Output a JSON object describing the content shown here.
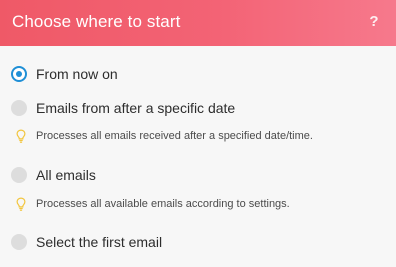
{
  "header": {
    "title": "Choose where to start",
    "help_label": "?"
  },
  "colors": {
    "accent": "#1f8fd6",
    "header_gradient_start": "#ef5967",
    "header_gradient_end": "#f6798c",
    "hint_icon": "#f2c53d"
  },
  "options": [
    {
      "label": "From now on",
      "selected": true,
      "icon": "radio-button-checked"
    },
    {
      "label": "Emails from after a specific date",
      "selected": false,
      "icon": "radio-button-unchecked",
      "hint": "Processes all emails received after a specified date/time."
    },
    {
      "label": "All emails",
      "selected": false,
      "icon": "radio-button-unchecked",
      "hint": "Processes all available emails according to settings."
    },
    {
      "label": "Select the first email",
      "selected": false,
      "icon": "radio-button-unchecked"
    }
  ],
  "hint_icon": "lightbulb-icon"
}
